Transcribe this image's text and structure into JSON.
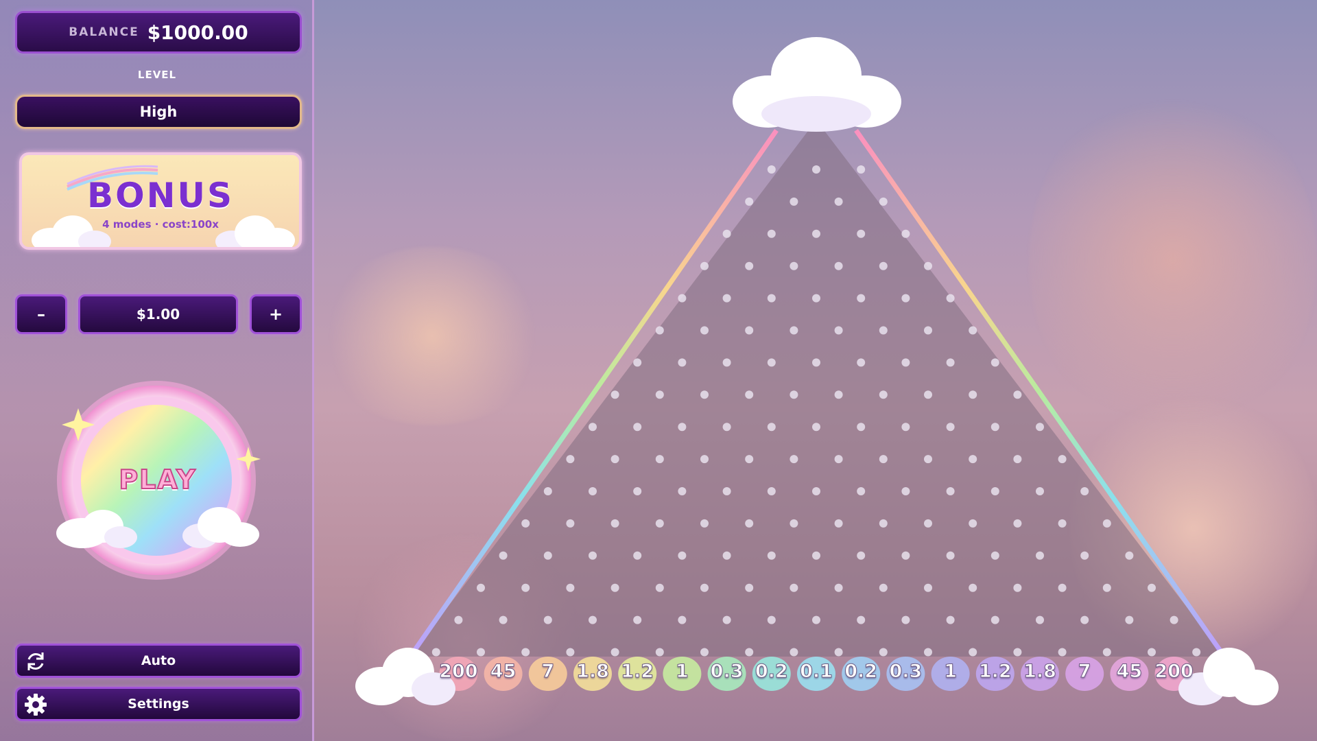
{
  "balance": {
    "label": "BALANCE",
    "value": "$1000.00"
  },
  "level": {
    "label": "LEVEL",
    "selected": "High"
  },
  "bonus": {
    "title": "BONUS",
    "subtitle": "4 modes · cost:100x"
  },
  "bet": {
    "decrement_label": "–",
    "value": "$1.00",
    "increment_label": "+"
  },
  "play": {
    "label": "PLAY"
  },
  "auto": {
    "label": "Auto",
    "icon": "refresh-icon"
  },
  "settings": {
    "label": "Settings",
    "icon": "gear-icon"
  },
  "board": {
    "peg_rows": 16,
    "multipliers": [
      "200",
      "45",
      "7",
      "1.8",
      "1.2",
      "1",
      "0.3",
      "0.2",
      "0.1",
      "0.2",
      "0.3",
      "1",
      "1.2",
      "1.8",
      "7",
      "45",
      "200"
    ],
    "multiplier_colors": [
      "#f7a8b8",
      "#f9b8a8",
      "#fbd09a",
      "#f8e49a",
      "#e6f29c",
      "#c8f2a0",
      "#a8f0c0",
      "#98ece0",
      "#9ae4f4",
      "#a0d4f8",
      "#a8c4f8",
      "#b0b4f6",
      "#bea8f4",
      "#cca4f0",
      "#daa4ec",
      "#e8a8e2",
      "#f4a8d0"
    ]
  }
}
